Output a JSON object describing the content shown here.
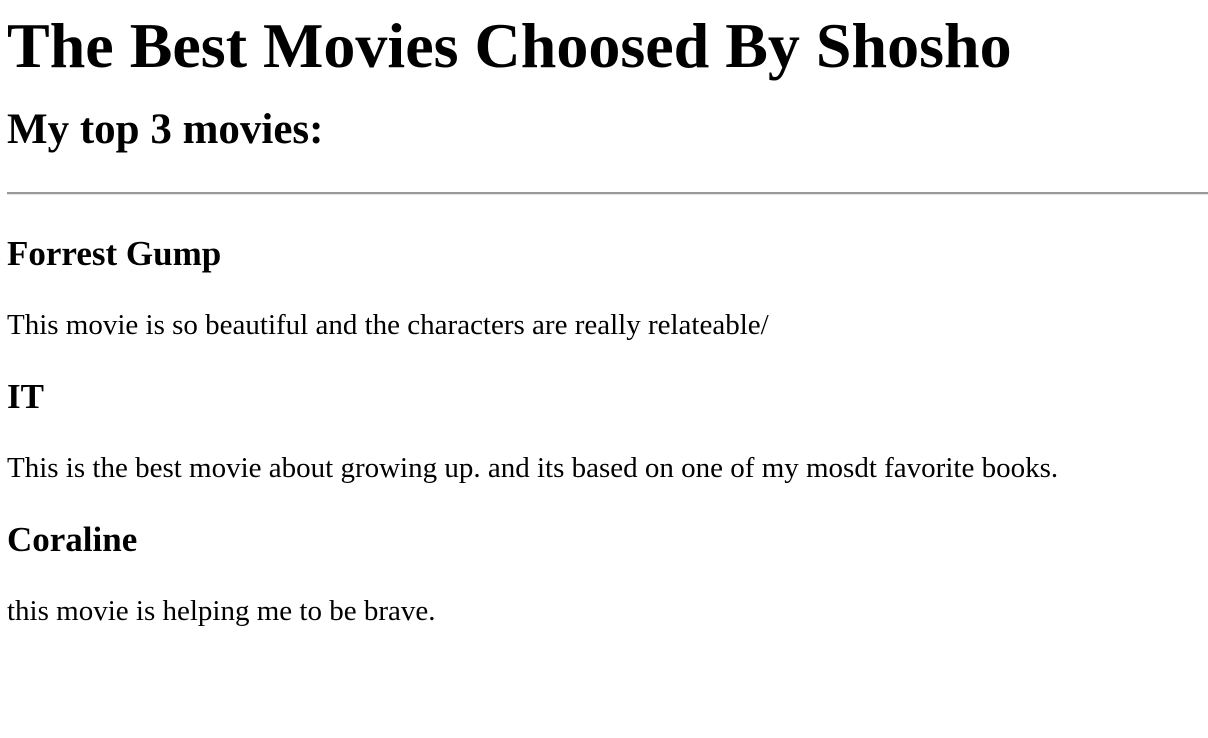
{
  "page": {
    "title": "The Best Movies Choosed By Shosho",
    "subtitle": "My top 3 movies:"
  },
  "movies": [
    {
      "title": "Forrest Gump",
      "description": "This movie is so beautiful and the characters are really relateable/"
    },
    {
      "title": "IT",
      "description": "This is the best movie about growing up. and its based on one of my mosdt favorite books."
    },
    {
      "title": "Coraline",
      "description": "this movie is helping me to be brave."
    }
  ]
}
